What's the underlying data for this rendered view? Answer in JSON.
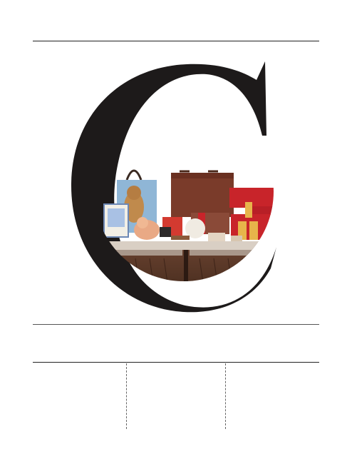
{
  "page": {
    "drop_letter": "C",
    "colors": {
      "letter": "#1d1a1a",
      "rules": "#222222",
      "background": "#ffffff",
      "gift_box_red": "#c8242a",
      "tote_leather": "#7a3b2a",
      "counter_wood": "#5a3523"
    }
  },
  "columns": [
    {
      "text": ""
    },
    {
      "text": ""
    },
    {
      "text": ""
    }
  ]
}
